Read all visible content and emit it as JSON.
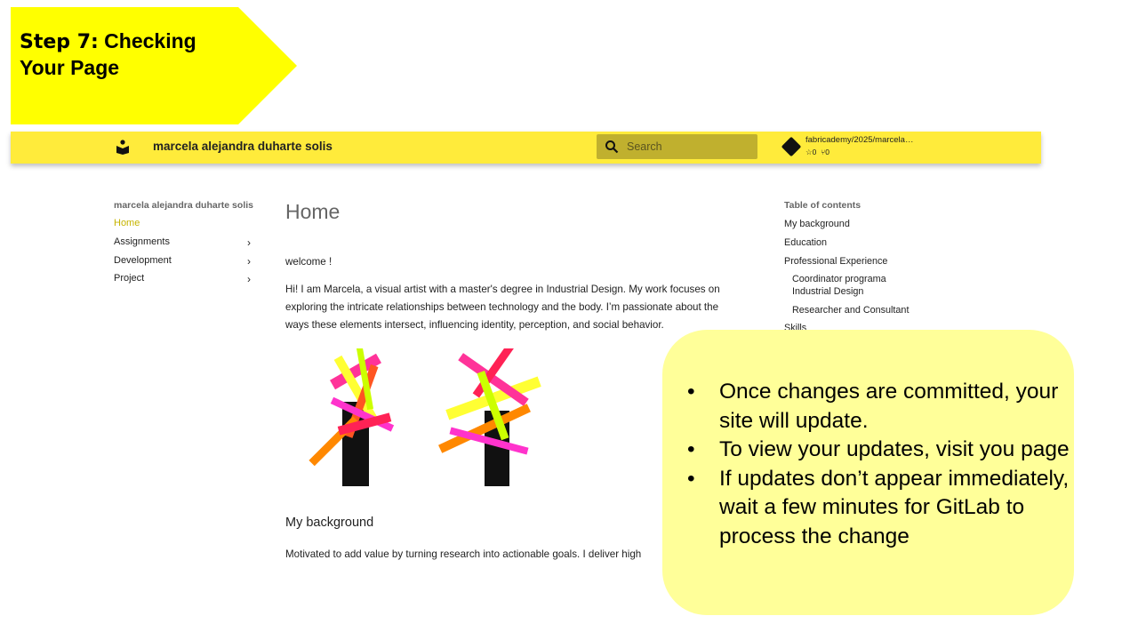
{
  "slide": {
    "title_step": "Step 7:",
    "title_rest": " Checking Your Page"
  },
  "header": {
    "site_title": "marcela alejandra duharte solis",
    "search_placeholder": "Search",
    "repo_name": "fabricademy/2025/marcela…",
    "stars": "☆0",
    "forks": "⑂0"
  },
  "sidebar": {
    "heading": "marcela alejandra duharte solis",
    "items": [
      {
        "label": "Home",
        "active": true
      },
      {
        "label": "Assignments"
      },
      {
        "label": "Development"
      },
      {
        "label": "Project"
      }
    ]
  },
  "main": {
    "title": "Home",
    "welcome": "welcome !",
    "intro_lines": [
      "Hi! I am Marcela, a visual artist with a master's degree in Industrial Design. My work focuses on",
      "exploring the intricate relationships between technology and the body. I’m passionate about the",
      "ways these elements intersect, influencing identity, perception, and social behavior."
    ],
    "section_heading": "My background",
    "section_text": "Motivated to add value by turning research into actionable goals. I deliver high"
  },
  "toc": {
    "heading": "Table of contents",
    "items": [
      "My background",
      "Education",
      "Professional Experience",
      "Coordinator programa Industrial Design",
      "Researcher and Consultant",
      "Skills"
    ]
  },
  "callout": {
    "bullets": [
      "Once changes are committed, your site will update.",
      "To view your updates, visit you page",
      "If updates don’t appear immediately, wait a few minutes for GitLab to process the change"
    ]
  },
  "colors": {
    "banner": "#ffff00",
    "topbar": "#ffeb3b",
    "callout": "#ffff99",
    "active_link": "#c6b400"
  }
}
